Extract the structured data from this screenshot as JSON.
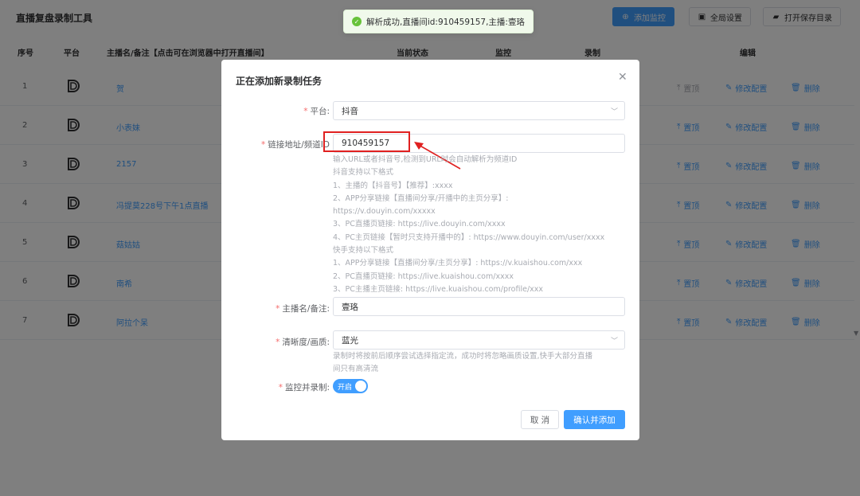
{
  "app": {
    "title": "直播复盘录制工具",
    "buttons": {
      "add_monitor": "添加监控",
      "global_settings": "全局设置",
      "open_save_dir": "打开保存目录"
    }
  },
  "table": {
    "headers": {
      "index": "序号",
      "platform": "平台",
      "anchor": "主播名/备注【点击可在浏览器中打开直播间】",
      "status": "当前状态",
      "monitor": "监控",
      "record": "录制",
      "edit": "编辑"
    },
    "actions": {
      "pin": "置顶",
      "edit_config": "修改配置",
      "delete": "删除"
    },
    "rows": [
      {
        "index": "1",
        "anchor": "贺"
      },
      {
        "index": "2",
        "anchor": "小表妹"
      },
      {
        "index": "3",
        "anchor": "2157"
      },
      {
        "index": "4",
        "anchor": "冯提莫228号下午1点直播"
      },
      {
        "index": "5",
        "anchor": "菇姑姑"
      },
      {
        "index": "6",
        "anchor": "南希"
      },
      {
        "index": "7",
        "anchor": "阿拉个呆"
      }
    ]
  },
  "toast": {
    "text": "解析成功,直播间id:910459157,主播:壹珞",
    "icon": "check-circle-icon",
    "color": "#67c23a"
  },
  "dialog": {
    "title": "正在添加新录制任务",
    "platform": {
      "label": "平台:",
      "value": "抖音"
    },
    "url": {
      "label": "链接地址/频道ID",
      "value": "910459157",
      "hint": [
        "输入URL或者抖音号,检测到URL时会自动解析为频道ID",
        "抖音支持以下格式",
        "1、主播的【抖音号】【推荐】:xxxx",
        "2、APP分享链接【直播间分享/开播中的主页分享】:",
        "https://v.douyin.com/xxxxx",
        "3、PC直播页链接: https://live.douyin.com/xxxx",
        "4、PC主页链接【暂时只支持开播中的】: https://www.douyin.com/user/xxxx",
        "快手支持以下格式",
        "1、APP分享链接【直播间分享/主页分享】: https://v.kuaishou.com/xxx",
        "2、PC直播页链接: https://live.kuaishou.com/xxxx",
        "3、PC主播主页链接: https://live.kuaishou.com/profile/xxx"
      ]
    },
    "anchor": {
      "label": "主播名/备注:",
      "value": "壹珞"
    },
    "quality": {
      "label": "清晰度/画质:",
      "value": "蓝光",
      "hint": [
        "录制时将按前后顺序尝试选择指定流，成功时将忽略画质设置,快手大部分直播",
        "间只有高清流"
      ]
    },
    "monitor": {
      "label": "监控并录制:",
      "toggle_text": "开启",
      "enabled": true
    },
    "cancel": "取 消",
    "confirm": "确认并添加"
  },
  "colors": {
    "primary": "#409eff",
    "required": "#f56c6c",
    "annotation": "#e02020"
  }
}
